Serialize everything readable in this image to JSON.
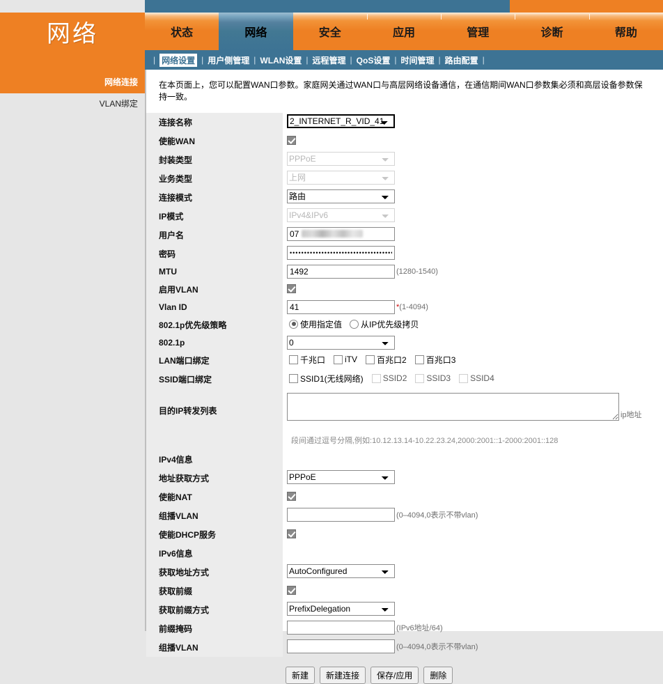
{
  "brand": {
    "title": "网络"
  },
  "tabs": [
    {
      "label": "状态",
      "active": false
    },
    {
      "label": "网络",
      "active": true
    },
    {
      "label": "安全",
      "active": false
    },
    {
      "label": "应用",
      "active": false
    },
    {
      "label": "管理",
      "active": false
    },
    {
      "label": "诊断",
      "active": false
    },
    {
      "label": "帮助",
      "active": false
    }
  ],
  "subnav": {
    "items": [
      {
        "label": "网络设置",
        "active": true
      },
      {
        "label": "用户侧管理",
        "active": false
      },
      {
        "label": "WLAN设置",
        "active": false
      },
      {
        "label": "远程管理",
        "active": false
      },
      {
        "label": "QoS设置",
        "active": false
      },
      {
        "label": "时间管理",
        "active": false
      },
      {
        "label": "路由配置",
        "active": false
      }
    ],
    "separator": "|"
  },
  "sidebar": {
    "items": [
      {
        "label": "网络连接",
        "active": true
      },
      {
        "label": "VLAN绑定",
        "active": false
      }
    ]
  },
  "main": {
    "intro": "在本页面上，您可以配置WAN口参数。家庭网关通过WAN口与高层网络设备通信，在通信期间WAN口参数集必须和高层设备参数保持一致。",
    "labels": {
      "conn_name": "连接名称",
      "enable_wan": "使能WAN",
      "encap_type": "封装类型",
      "service_type": "业务类型",
      "conn_mode": "连接模式",
      "ip_mode": "IP模式",
      "username": "用户名",
      "password": "密码",
      "mtu": "MTU",
      "enable_vlan": "启用VLAN",
      "vlan_id": "Vlan ID",
      "dot1p_policy": "802.1p优先级策略",
      "dot1p": "802.1p",
      "lan_bind": "LAN端口绑定",
      "ssid_bind": "SSID端口绑定",
      "dest_ip_fwd": "目的IP转发列表",
      "ipv4_info": "IPv4信息",
      "addr_method": "地址获取方式",
      "enable_nat": "使能NAT",
      "mcast_vlan": "组播VLAN",
      "enable_dhcp": "使能DHCP服务",
      "ipv6_info": "IPv6信息",
      "v6_addr_method": "获取地址方式",
      "get_prefix": "获取前缀",
      "prefix_method": "获取前缀方式",
      "prefix_mask": "前缀掩码",
      "v6_mcast_vlan": "组播VLAN"
    },
    "values": {
      "conn_name": "2_INTERNET_R_VID_41",
      "enable_wan_checked": true,
      "encap_type": "PPPoE",
      "service_type": "上网",
      "conn_mode": "路由",
      "ip_mode": "IPv4&IPv6",
      "username": "07",
      "password": "••••••••••••••••••••••••••••••••••••",
      "mtu": "1492",
      "mtu_hint": "(1280-1540)",
      "enable_vlan_checked": true,
      "vlan_id": "41",
      "vlan_id_req": "*",
      "vlan_id_hint": "(1-4094)",
      "dot1p_policy_options": [
        "使用指定值",
        "从IP优先级拷贝"
      ],
      "dot1p_policy_selected": 0,
      "dot1p": "0",
      "lan_bind_options": [
        "千兆口",
        "iTV",
        "百兆口2",
        "百兆口3"
      ],
      "ssid_bind_options": [
        "SSID1(无线网络)",
        "SSID2",
        "SSID3",
        "SSID4"
      ],
      "dest_ip_fwd": "",
      "dest_ip_fwd_suffix": "ip地址",
      "dest_ip_fwd_note": "段间通过逗号分隔,例如:10.12.13.14-10.22.23.24,2000:2001::1-2000:2001::128",
      "addr_method": "PPPoE",
      "enable_nat_checked": true,
      "mcast_vlan": "",
      "mcast_vlan_hint": "(0–4094,0表示不带vlan)",
      "enable_dhcp_checked": true,
      "v6_addr_method": "AutoConfigured",
      "get_prefix_checked": true,
      "prefix_method": "PrefixDelegation",
      "prefix_mask": "",
      "prefix_mask_hint": "(IPv6地址/64)",
      "v6_mcast_vlan": "",
      "v6_mcast_vlan_hint": "(0–4094,0表示不带vlan)"
    },
    "buttons": {
      "new": "新建",
      "new_conn": "新建连接",
      "save_apply": "保存/应用",
      "delete": "删除"
    }
  },
  "colors": {
    "brand_orange": "#ee8023",
    "brand_blue": "#3d7394",
    "label_bg": "#ececec",
    "page_bg": "#e6e6e6"
  }
}
